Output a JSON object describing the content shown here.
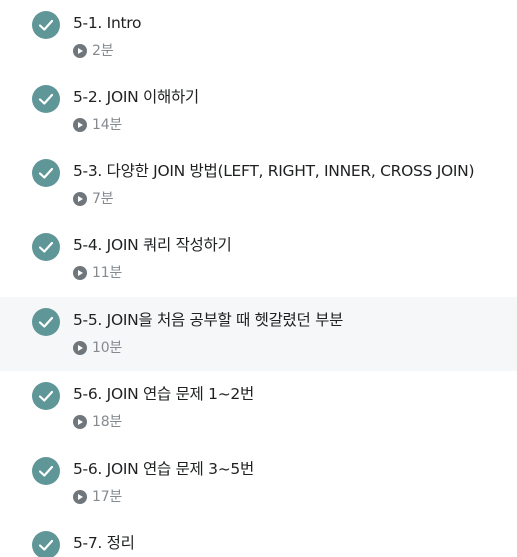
{
  "lectures": [
    {
      "title": "5-1. Intro",
      "duration": "2분",
      "completed": true,
      "active": false
    },
    {
      "title": "5-2. JOIN 이해하기",
      "duration": "14분",
      "completed": true,
      "active": false
    },
    {
      "title": "5-3. 다양한 JOIN 방법(LEFT, RIGHT, INNER, CROSS JOIN)",
      "duration": "7분",
      "completed": true,
      "active": false
    },
    {
      "title": "5-4. JOIN 쿼리 작성하기",
      "duration": "11분",
      "completed": true,
      "active": false
    },
    {
      "title": "5-5. JOIN을 처음 공부할 때 헷갈렸던 부분",
      "duration": "10분",
      "completed": true,
      "active": true
    },
    {
      "title": "5-6. JOIN 연습 문제 1~2번",
      "duration": "18분",
      "completed": true,
      "active": false
    },
    {
      "title": "5-6. JOIN 연습 문제 3~5번",
      "duration": "17분",
      "completed": true,
      "active": false
    },
    {
      "title": "5-7. 정리",
      "duration": "",
      "completed": true,
      "active": false
    }
  ],
  "colors": {
    "check_circle": "#5f9698",
    "active_row_bg": "#f5f7f8",
    "title_text": "#1e2022",
    "duration_text": "#858a8f",
    "play_icon": "#6f767c"
  },
  "icons": {
    "completed": "check-circle-icon",
    "duration": "play-circle-icon"
  }
}
